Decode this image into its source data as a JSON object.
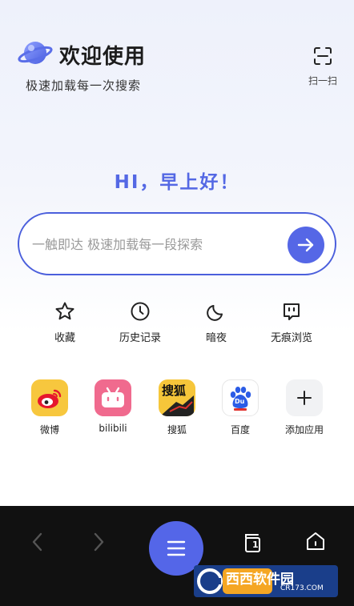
{
  "header": {
    "welcome_title": "欢迎使用",
    "tagline": "极速加载每一次搜索",
    "scan_label": "扫一扫"
  },
  "greeting": "HI，早上好！",
  "search": {
    "placeholder": "一触即达 极速加载每一段探索",
    "value": ""
  },
  "quick_actions": [
    {
      "label": "收藏",
      "icon": "star-icon"
    },
    {
      "label": "历史记录",
      "icon": "clock-icon"
    },
    {
      "label": "暗夜",
      "icon": "moon-icon"
    },
    {
      "label": "无痕浏览",
      "icon": "ghost-icon"
    }
  ],
  "apps": [
    {
      "label": "微博",
      "icon": "weibo-icon"
    },
    {
      "label": "bilibili",
      "icon": "bilibili-icon"
    },
    {
      "label": "搜狐",
      "icon": "sohu-icon",
      "icon_text": "搜狐"
    },
    {
      "label": "百度",
      "icon": "baidu-icon",
      "icon_text": "Du"
    },
    {
      "label": "添加应用",
      "icon": "plus-icon"
    }
  ],
  "bottom_bar": {
    "tab_count": "1"
  },
  "watermark": {
    "brand": "西西软件园",
    "url": "CR173.COM"
  },
  "colors": {
    "accent": "#5567e6",
    "bottom_bar": "#111111"
  }
}
